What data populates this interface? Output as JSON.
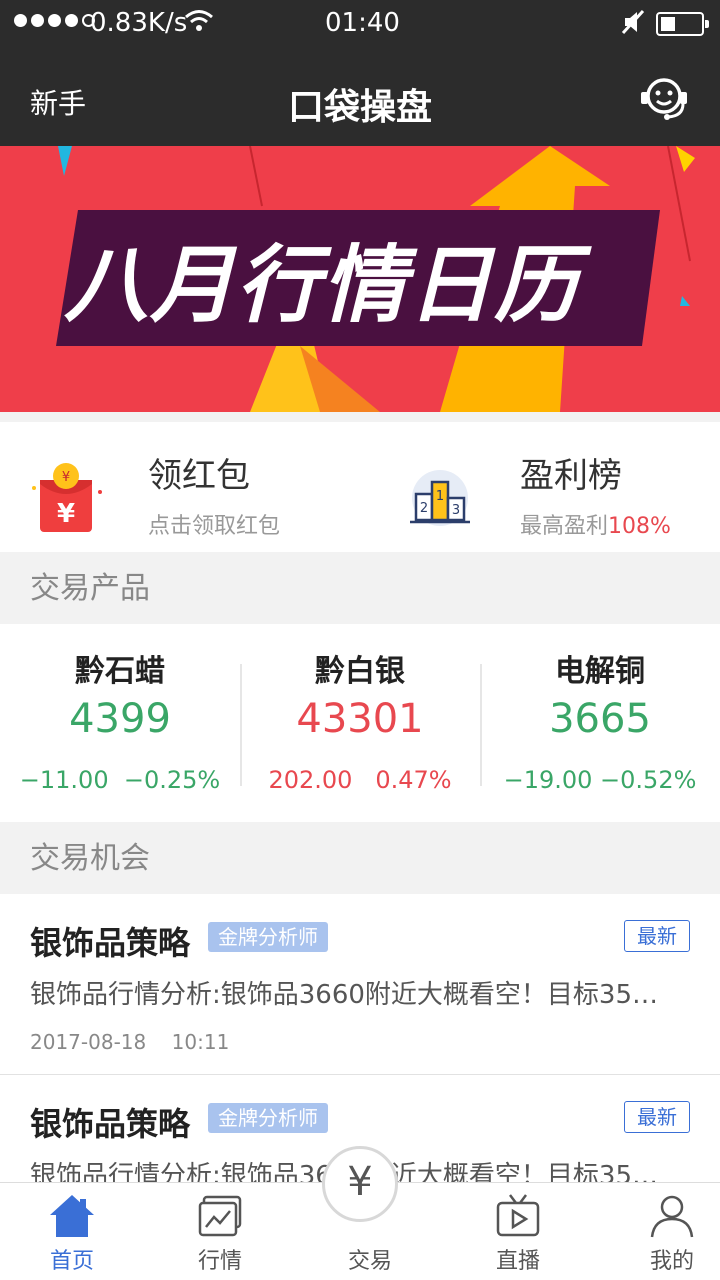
{
  "status_bar": {
    "speed": "0.83K/s",
    "time": "01:40",
    "wifi_icon": "wifi-icon",
    "mute_icon": "mute-icon",
    "battery_icon": "battery-icon"
  },
  "header": {
    "left_label": "新手",
    "title": "口袋操盘",
    "right_icon": "customer-support-icon"
  },
  "banner": {
    "text": "八月行情日历"
  },
  "promo": {
    "red_packet": {
      "title": "领红包",
      "subtitle": "点击领取红包",
      "icon": "red-packet-icon"
    },
    "ranking": {
      "title": "盈利榜",
      "subtitle_prefix": "最高盈利",
      "subtitle_highlight": "108%",
      "icon": "podium-icon"
    }
  },
  "sections": {
    "products": "交易产品",
    "opportunities": "交易机会"
  },
  "products": [
    {
      "name": "黔石蜡",
      "price": "4399",
      "change": "−11.00",
      "change_pct": "−0.25%",
      "trend": "down"
    },
    {
      "name": "黔白银",
      "price": "43301",
      "change": "202.00",
      "change_pct": "0.47%",
      "trend": "up"
    },
    {
      "name": "电解铜",
      "price": "3665",
      "change": "−19.00",
      "change_pct": "−0.52%",
      "trend": "down"
    }
  ],
  "opportunities": [
    {
      "title": "银饰品策略",
      "badge": "金牌分析师",
      "tag": "最新",
      "desc": "银饰品行情分析:银饰品3660附近大概看空！目标35…",
      "date": "2017-08-18",
      "time": "10:11"
    },
    {
      "title": "银饰品策略",
      "badge": "金牌分析师",
      "tag": "最新",
      "desc": "银饰品行情分析:银饰品3660附近大概看空！目标35…"
    }
  ],
  "tabbar": {
    "home": "首页",
    "market": "行情",
    "trade": "交易",
    "trade_symbol": "¥",
    "live": "直播",
    "mine": "我的"
  },
  "colors": {
    "up": "#e8484f",
    "down": "#3aa667",
    "accent": "#3a6fd6",
    "header_bg": "#2c2c2c",
    "banner_bg": "#ef3e4a"
  }
}
